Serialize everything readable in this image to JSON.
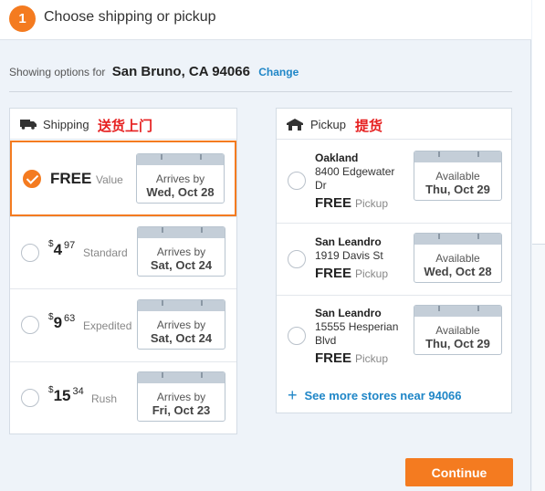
{
  "header": {
    "step": "1",
    "title": "Choose shipping or pickup"
  },
  "location": {
    "prefix": "Showing options for",
    "city": "San Bruno, CA 94066",
    "change": "Change"
  },
  "shipping": {
    "label": "Shipping",
    "annotation": "送货上门",
    "options": [
      {
        "price_text": "FREE",
        "tier": "Value",
        "cal_top": "Arrives by",
        "cal_date": "Wed, Oct 28",
        "selected": true
      },
      {
        "dollar": "$",
        "whole": "4",
        "cents": "97",
        "tier": "Standard",
        "cal_top": "Arrives by",
        "cal_date": "Sat, Oct 24",
        "selected": false
      },
      {
        "dollar": "$",
        "whole": "9",
        "cents": "63",
        "tier": "Expedited",
        "cal_top": "Arrives by",
        "cal_date": "Sat, Oct 24",
        "selected": false
      },
      {
        "dollar": "$",
        "whole": "15",
        "cents": "34",
        "tier": "Rush",
        "cal_top": "Arrives by",
        "cal_date": "Fri, Oct 23",
        "selected": false
      }
    ]
  },
  "pickup": {
    "label": "Pickup",
    "annotation": "提货",
    "stores": [
      {
        "name": "Oakland",
        "address": "8400 Edgewater Dr",
        "price": "FREE",
        "type": "Pickup",
        "cal_top": "Available",
        "cal_date": "Thu, Oct 29"
      },
      {
        "name": "San Leandro",
        "address": "1919 Davis St",
        "price": "FREE",
        "type": "Pickup",
        "cal_top": "Available",
        "cal_date": "Wed, Oct 28"
      },
      {
        "name": "San Leandro",
        "address": "15555 Hesperian Blvd",
        "price": "FREE",
        "type": "Pickup",
        "cal_top": "Available",
        "cal_date": "Thu, Oct 29"
      }
    ],
    "see_more": "See more stores near 94066"
  },
  "actions": {
    "continue": "Continue"
  },
  "colors": {
    "accent": "#f47b20",
    "link": "#1f86c7",
    "annotation": "#e62020"
  },
  "icons": {
    "shipping": "truck-icon",
    "pickup": "store-icon",
    "see_more": "plus-icon",
    "selected": "checkmark-icon"
  }
}
